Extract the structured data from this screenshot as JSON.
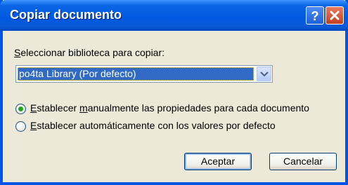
{
  "dialog": {
    "title": "Copiar documento",
    "library_label_mnemonic": "S",
    "library_label_rest": "eleccionar biblioteca para copiar:",
    "library_selected": "po4ta Library  (Por defecto)",
    "option_manual": {
      "mnemonic": "E",
      "text_before": "stablecer ",
      "text_underlined": "m",
      "text_after": "anualmente las propiedades para cada documento",
      "selected": true
    },
    "option_auto": {
      "mnemonic": "E",
      "text_after": "stablecer automáticamente con los valores por defecto",
      "selected": false
    },
    "ok_label": "Aceptar",
    "cancel_label": "Cancelar"
  },
  "colors": {
    "titlebar": "#0058E0",
    "dialog_bg": "#ECE9D8",
    "selection": "#316AC5",
    "radio_dot": "#21A121"
  },
  "icons": [
    "help-icon",
    "close-icon",
    "chevron-down-icon"
  ]
}
